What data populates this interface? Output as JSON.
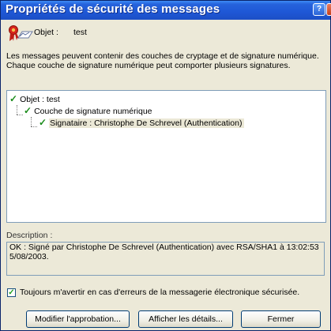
{
  "window": {
    "title": "Propriétés de sécurité des messages",
    "help_button": "?"
  },
  "object": {
    "label": "Objet :",
    "value": "test"
  },
  "intro_text": "Les messages peuvent contenir des couches de cryptage et de signature numérique. Chaque couche de signature numérique peut comporter plusieurs signatures.",
  "tree": [
    {
      "label": "Objet : test"
    },
    {
      "label": "Couche de signature numérique"
    },
    {
      "label": "Signataire : Christophe De Schrevel (Authentication)"
    }
  ],
  "description": {
    "label": "Description :",
    "text": "OK : Signé par Christophe De Schrevel (Authentication) avec RSA/SHA1 à 13:02:53 5/08/2003."
  },
  "warn_checkbox": {
    "label": "Toujours m'avertir en cas d'erreurs de la messagerie électronique sécurisée.",
    "checked": true
  },
  "buttons": {
    "edit_trust": "Modifier l'approbation...",
    "view_details": "Afficher les détails...",
    "close": "Fermer"
  },
  "colors": {
    "titlebar": "#2663dc",
    "dialog_bg": "#ece9d8",
    "check_green": "#1b8c1b"
  },
  "icons": {
    "seal": "certificate-seal-icon",
    "check": "green-checkmark-icon"
  }
}
